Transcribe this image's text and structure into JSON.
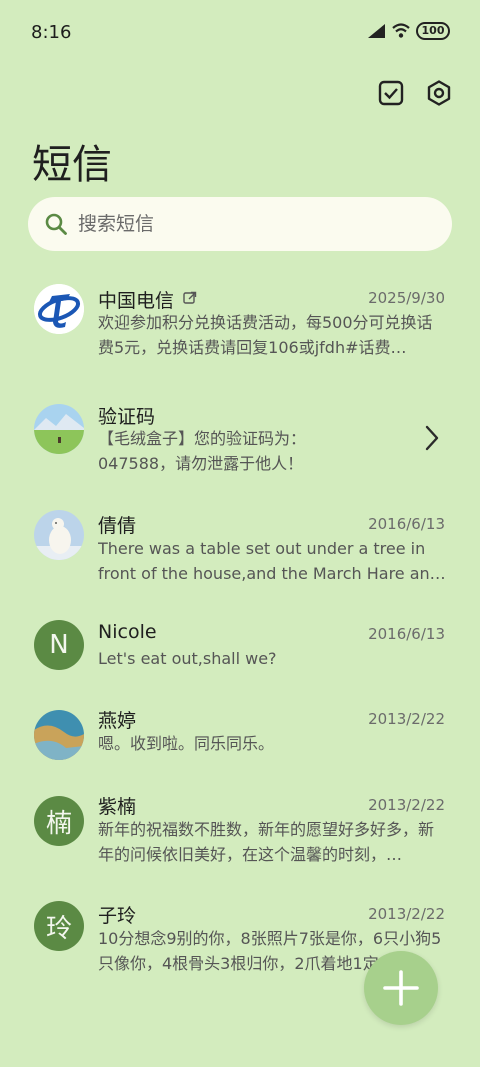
{
  "status_bar": {
    "time": "8:16",
    "battery": "100"
  },
  "header": {
    "title": "短信"
  },
  "search": {
    "placeholder": "搜索短信"
  },
  "conversations": [
    {
      "name": "中国电信",
      "date": "2025/9/30",
      "preview": "欢迎参加积分兑换话费活动，每500分可兑换话费5元，兑换话费请回复106或jfdh#话费…",
      "avatar": "china-telecom-logo",
      "badge": "external-link-icon"
    },
    {
      "name": "验证码",
      "date": "",
      "preview": "【毛绒盒子】您的验证码为：047588，请勿泄露于他人！",
      "avatar": "landscape-photo"
    },
    {
      "name": "倩倩",
      "date": "2016/6/13",
      "preview": "There was a table set out under a tree in front of the house,and the March Hare an…",
      "avatar": "polar-bear-photo"
    },
    {
      "name": "Nicole",
      "date": "2016/6/13",
      "preview": "Let's eat out,shall we?",
      "avatar_letter": "N"
    },
    {
      "name": "燕婷",
      "date": "2013/2/22",
      "preview": "嗯。收到啦。同乐同乐。",
      "avatar": "coast-photo"
    },
    {
      "name": "紫楠",
      "date": "2013/2/22",
      "preview": "新年的祝福数不胜数，新年的愿望好多好多，新年的问候依旧美好，在这个温馨的时刻，…",
      "avatar_letter": "楠"
    },
    {
      "name": "子玲",
      "date": "2013/2/22",
      "preview": "10分想念9别的你，8张照片7张是你，6只小狗5只像你，4根骨头3根归你，2爪着地1定…",
      "avatar_letter": "玲"
    }
  ],
  "colors": {
    "background": "#d3ecbe",
    "accent": "#5b8a44",
    "fab": "#a7d08c"
  }
}
